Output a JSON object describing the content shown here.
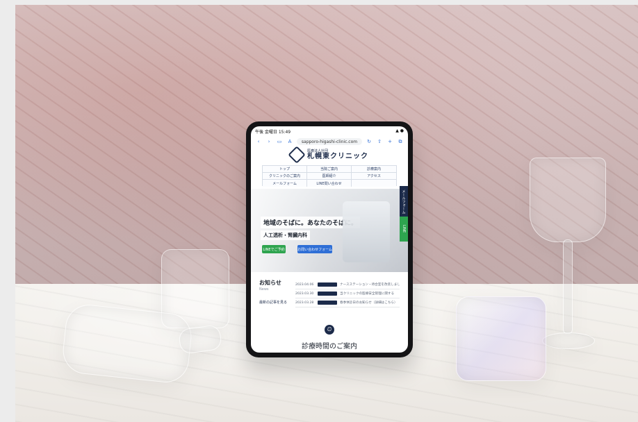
{
  "tablet": {
    "status_left": "午後 金曜日 15:49",
    "status_right": "▲ ●",
    "browser": {
      "url": "sapporo-higashi-clinic.com",
      "left_icons": [
        "chevron-left-icon",
        "chevron-right-icon",
        "sidebar-icon",
        "aa-icon"
      ],
      "right_icons": [
        "reload-icon",
        "share-icon",
        "plus-icon",
        "tabs-icon"
      ]
    },
    "site": {
      "org": "医療法人社団",
      "name": "札幌東クリニック",
      "nav": [
        "トップ",
        "当院ご案内",
        "診療案内",
        "クリニックのご案内",
        "医師紹介",
        "アクセス",
        "メールフォーム",
        "LINE問い合わせ",
        ""
      ],
      "hero": {
        "title": "地域のそばに。あなたのそばに。",
        "subtitle": "人工透析・腎臓内科",
        "btn_line": "LINEでご予約",
        "btn_form": "お問い合わせフォーム"
      },
      "side_tabs": {
        "mail": "メールフォーム",
        "line": "LINE"
      },
      "news": {
        "title": "お知らせ",
        "en": "News",
        "more": "最新の記事を見る",
        "items": [
          {
            "date": "2023.04.06",
            "text": "ナースステーション・待合室を改装しました"
          },
          {
            "date": "2023.03.30",
            "text": "当クリニックの医療安全管理に関する"
          },
          {
            "date": "2023.03.28",
            "text": "春季休診日のお知らせ（詳細はこちら）"
          }
        ]
      },
      "hours_title": "診療時間のご案内"
    }
  }
}
